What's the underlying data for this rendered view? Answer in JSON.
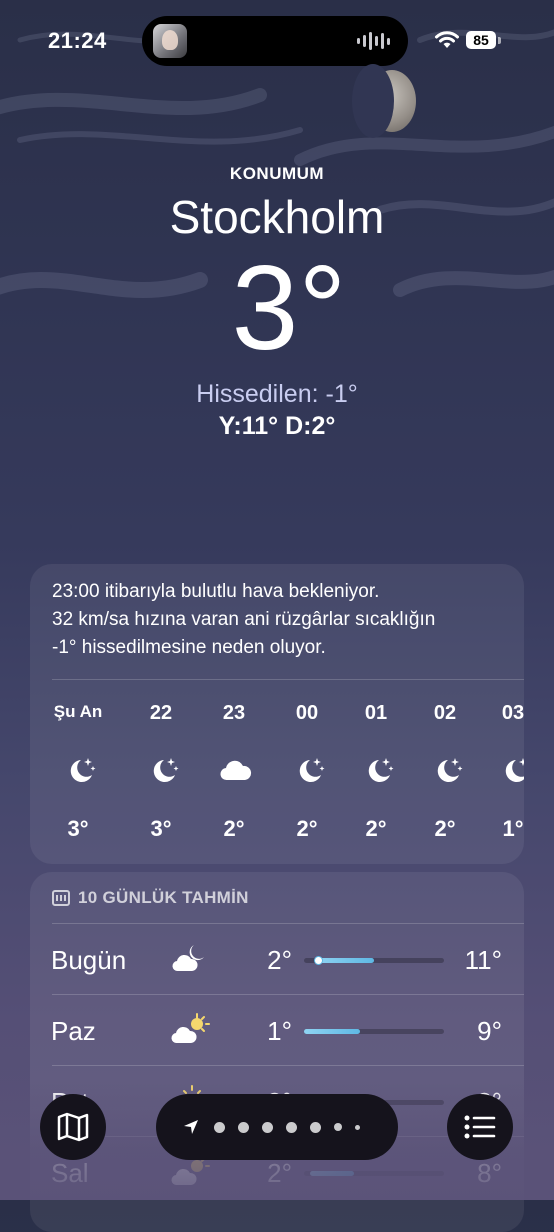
{
  "status_bar": {
    "time": "21:24",
    "battery": "85"
  },
  "location": {
    "label": "KONUMUM",
    "city": "Stockholm",
    "temperature": "3°",
    "feels_like": "Hissedilen: -1°",
    "high_low": "Y:11° D:2°"
  },
  "hourly": {
    "summary_lines": [
      "23:00 itibarıyla bulutlu hava bekleniyor.",
      "32 km/sa hızına varan ani rüzgârlar sıcaklığın",
      "-1° hissedilmesine neden oluyor."
    ],
    "items": [
      {
        "label": "Şu An",
        "icon": "moon-stars-icon",
        "temp": "3°"
      },
      {
        "label": "22",
        "icon": "moon-stars-icon",
        "temp": "3°"
      },
      {
        "label": "23",
        "icon": "cloud-icon",
        "temp": "2°"
      },
      {
        "label": "00",
        "icon": "moon-stars-icon",
        "temp": "2°"
      },
      {
        "label": "01",
        "icon": "moon-stars-icon",
        "temp": "2°"
      },
      {
        "label": "02",
        "icon": "moon-stars-icon",
        "temp": "2°"
      },
      {
        "label": "03",
        "icon": "moon-stars-icon",
        "temp": "1°"
      }
    ]
  },
  "daily": {
    "title": "10 GÜNLÜK TAHMİN",
    "items": [
      {
        "day": "Bugün",
        "icon": "cloud-moon-icon",
        "low": "2°",
        "high": "11°",
        "range_start": 0.08,
        "range_end": 0.5,
        "current": 0.1
      },
      {
        "day": "Paz",
        "icon": "cloud-sun-icon",
        "low": "1°",
        "high": "9°",
        "range_start": 0.0,
        "range_end": 0.4
      },
      {
        "day": "Pzt",
        "icon": "sun-icon",
        "low": "2°",
        "high": "8°",
        "range_start": 0.05,
        "range_end": 0.35
      },
      {
        "day": "Sal",
        "icon": "cloud-sun-icon",
        "low": "2°",
        "high": "8°",
        "range_start": 0.04,
        "range_end": 0.36
      }
    ]
  },
  "toolbar": {
    "map_icon": "map-icon",
    "list_icon": "list-icon",
    "page_count": 7,
    "current_page": "location"
  }
}
